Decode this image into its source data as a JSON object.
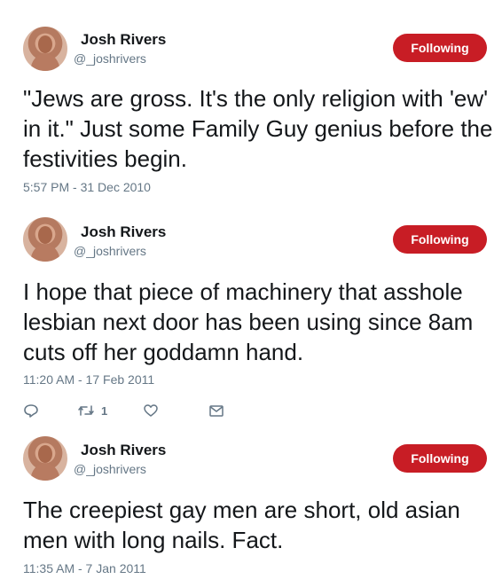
{
  "tweets": [
    {
      "name": "Josh Rivers",
      "handle": "@_joshrivers",
      "follow_label": "Following",
      "text": "\"Jews are gross. It's the only religion with 'ew' in it.\" Just some Family Guy genius before the festivities begin.",
      "timestamp": "5:57 PM - 31 Dec 2010"
    },
    {
      "name": "Josh Rivers",
      "handle": "@_joshrivers",
      "follow_label": "Following",
      "text": "I hope that piece of machinery that asshole lesbian next door has been using since 8am cuts off her goddamn hand.",
      "timestamp": "11:20 AM - 17 Feb 2011",
      "actions": {
        "retweet_count": "1"
      }
    },
    {
      "name": "Josh Rivers",
      "handle": "@_joshrivers",
      "follow_label": "Following",
      "text": "The creepiest gay men are short, old asian men with long nails. Fact.",
      "timestamp": "11:35 AM - 7 Jan 2011"
    }
  ],
  "colors": {
    "follow_button": "#c81d25",
    "secondary_text": "#657786",
    "primary_text": "#14171a"
  },
  "icons": [
    "reply-icon",
    "retweet-icon",
    "like-icon",
    "message-icon"
  ]
}
